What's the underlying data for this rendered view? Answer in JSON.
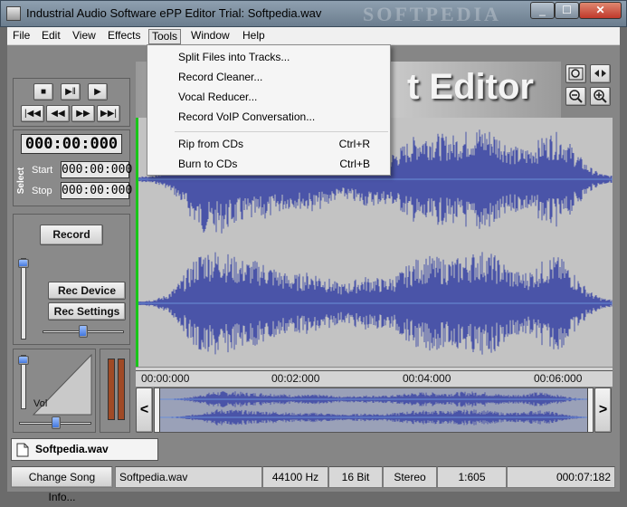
{
  "window": {
    "title": "Industrial Audio Software ePP Editor Trial: Softpedia.wav",
    "watermark": "SOFTPEDIA",
    "minimize": "_",
    "maximize": "☐",
    "close": "✕"
  },
  "menubar": {
    "file": "File",
    "edit": "Edit",
    "view": "View",
    "effects": "Effects",
    "tools": "Tools",
    "window": "Window",
    "help": "Help"
  },
  "tools_menu": {
    "items": [
      {
        "label": "Split Files into Tracks...",
        "shortcut": ""
      },
      {
        "label": "Record Cleaner...",
        "shortcut": ""
      },
      {
        "label": "Vocal Reducer...",
        "shortcut": ""
      },
      {
        "label": "Record VoIP Conversation...",
        "shortcut": ""
      },
      {
        "label": "Rip from CDs",
        "shortcut": "Ctrl+R"
      },
      {
        "label": "Burn to CDs",
        "shortcut": "Ctrl+B"
      }
    ]
  },
  "header": {
    "text": "t Editor"
  },
  "transport": {
    "stop": "■",
    "play_pause": "▶‖",
    "play": "▶",
    "rewind_start": "|◀◀",
    "rewind": "◀◀",
    "forward": "▶▶",
    "forward_end": "▶▶|"
  },
  "position": {
    "current": "000:00:000",
    "select_label": "Select",
    "start_label": "Start",
    "start_value": "000:00:000",
    "stop_label": "Stop",
    "stop_value": "000:00:000"
  },
  "record": {
    "record_label": "Record",
    "rec_device_label": "Rec Device",
    "rec_settings_label": "Rec Settings",
    "vol_label": "Vol"
  },
  "timeline": {
    "ticks": [
      "00:00:000",
      "00:02:000",
      "00:04:000",
      "00:06:000"
    ]
  },
  "overview": {
    "left_arrow": "<",
    "right_arrow": ">"
  },
  "file_tab": {
    "name": "Softpedia.wav"
  },
  "status": {
    "change_song_info": "Change Song Info...",
    "filename": "Softpedia.wav",
    "sample_rate": "44100 Hz",
    "bit_depth": "16 Bit",
    "channels": "Stereo",
    "ratio": "1:605",
    "length": "000:07:182"
  },
  "colors": {
    "waveform": "#4a54a8",
    "wave_bg": "#c3c3c3",
    "marker": "#19c619",
    "vu_fill": "#a04a26"
  },
  "icons": {
    "zoom_fit": "zoom-fit-icon",
    "zoom_out": "zoom-out-icon",
    "zoom_in": "zoom-in-icon",
    "zoom_horizontal": "zoom-horizontal-icon"
  }
}
